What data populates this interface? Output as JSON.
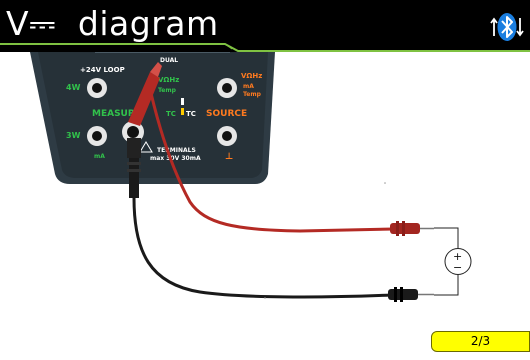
{
  "header": {
    "title": "V⎓  diagram",
    "title_symbol": "V⎓",
    "title_text": "diagram"
  },
  "status": {
    "bluetooth_icon": "bluetooth-icon",
    "transfer_icon": "up-down-arrows-icon"
  },
  "meter": {
    "loop_label": "+24V LOOP",
    "dual_label": "DUAL",
    "jack_4w_label": "4W",
    "jack_3w_label": "3W",
    "ma_label": "mA",
    "measure_label": "MEASURE",
    "source_label": "SOURCE",
    "vohz_label": "VΩHz",
    "temp_label": "Temp",
    "tc_label": "TC",
    "tc2_label": "TC",
    "right_top_label": "VΩHz",
    "right_ma_label": "mA",
    "right_temp_label": "Temp",
    "terminals_label": "TERMINALS",
    "rating_label": "max 30V 30mA",
    "ground_symbol": "⊥"
  },
  "source_symbol": {
    "plus": "+",
    "minus": "−"
  },
  "page_indicator": "2/3",
  "colors": {
    "header_bg": "#000000",
    "accent_line": "#7fc242",
    "probe_red": "#b42a24",
    "probe_black": "#1a1a1a",
    "meter_body": "#2e3b44",
    "label_green": "#31c24b",
    "label_orange": "#ff7a1f",
    "page_indicator_bg": "#ffff00"
  }
}
